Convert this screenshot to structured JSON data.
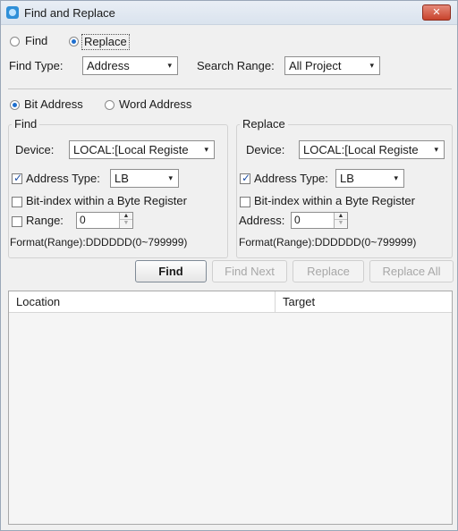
{
  "window": {
    "title": "Find and Replace",
    "close_glyph": "✕"
  },
  "mode": {
    "find_label": "Find",
    "replace_label": "Replace",
    "selected": "Replace"
  },
  "find_type": {
    "label": "Find Type:",
    "value": "Address"
  },
  "search_range": {
    "label": "Search Range:",
    "value": "All Project"
  },
  "address_kind": {
    "bit_label": "Bit Address",
    "word_label": "Word Address",
    "selected": "Bit Address"
  },
  "find_group": {
    "title": "Find",
    "device_label": "Device:",
    "device_value": "LOCAL:[Local Registe",
    "address_type_label": "Address Type:",
    "address_type_value": "LB",
    "address_type_checked": true,
    "bit_index_label": "Bit-index within a Byte Register",
    "range_label": "Range:",
    "range_value": "0",
    "format_text": "Format(Range):DDDDDD(0~799999)"
  },
  "replace_group": {
    "title": "Replace",
    "device_label": "Device:",
    "device_value": "LOCAL:[Local Registe",
    "address_type_label": "Address Type:",
    "address_type_value": "LB",
    "address_type_checked": true,
    "bit_index_label": "Bit-index within a Byte Register",
    "address_label": "Address:",
    "address_value": "0",
    "format_text": "Format(Range):DDDDDD(0~799999)"
  },
  "buttons": {
    "find": "Find",
    "find_next": "Find Next",
    "replace": "Replace",
    "replace_all": "Replace All"
  },
  "results": {
    "columns": [
      "Location",
      "Target"
    ],
    "rows": []
  },
  "icons": {
    "dropdown": "▾",
    "spin_up": "▲",
    "spin_down": "▼"
  }
}
